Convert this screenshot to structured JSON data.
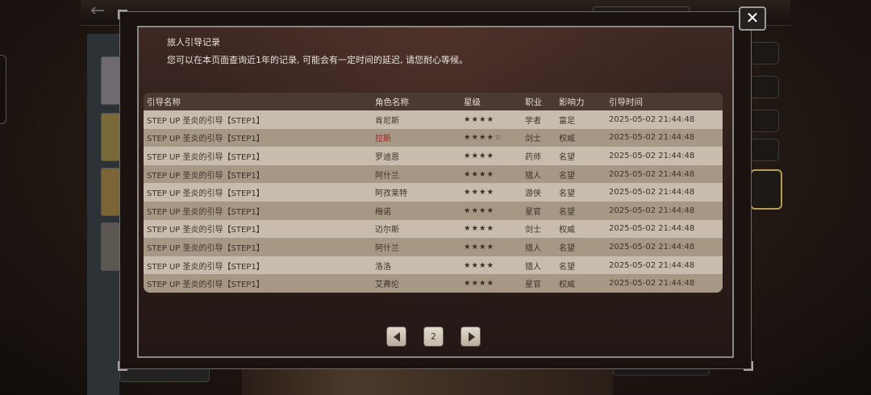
{
  "modal": {
    "title": "旅人引导记录",
    "description": "您可以在本页面查询近1年的记录, 可能会有一定时间的延迟, 请您耐心等候。",
    "close_icon": "✕"
  },
  "table": {
    "headers": [
      "引导名称",
      "角色名称",
      "星级",
      "职业",
      "影响力",
      "引导时间"
    ],
    "rows": [
      {
        "guide": "STEP UP 圣炎的引导【STEP1】",
        "character": "肯尼斯",
        "stars": "★★★★",
        "job": "学者",
        "influence": "富足",
        "time": "2025-05-02 21:44:48"
      },
      {
        "guide": "STEP UP 圣炎的引导【STEP1】",
        "character": "拉斯",
        "stars": "★★★★☆",
        "job": "剑士",
        "influence": "权威",
        "time": "2025-05-02 21:44:48"
      },
      {
        "guide": "STEP UP 圣炎的引导【STEP1】",
        "character": "罗迪恩",
        "stars": "★★★★",
        "job": "药师",
        "influence": "名望",
        "time": "2025-05-02 21:44:48"
      },
      {
        "guide": "STEP UP 圣炎的引导【STEP1】",
        "character": "阿什兰",
        "stars": "★★★★",
        "job": "猎人",
        "influence": "名望",
        "time": "2025-05-02 21:44:48"
      },
      {
        "guide": "STEP UP 圣炎的引导【STEP1】",
        "character": "阿孜莱特",
        "stars": "★★★★",
        "job": "游侠",
        "influence": "名望",
        "time": "2025-05-02 21:44:48"
      },
      {
        "guide": "STEP UP 圣炎的引导【STEP1】",
        "character": "梅诺",
        "stars": "★★★★",
        "job": "星官",
        "influence": "名望",
        "time": "2025-05-02 21:44:48"
      },
      {
        "guide": "STEP UP 圣炎的引导【STEP1】",
        "character": "迈尔斯",
        "stars": "★★★★",
        "job": "剑士",
        "influence": "权威",
        "time": "2025-05-02 21:44:48"
      },
      {
        "guide": "STEP UP 圣炎的引导【STEP1】",
        "character": "阿什兰",
        "stars": "★★★★",
        "job": "猎人",
        "influence": "名望",
        "time": "2025-05-02 21:44:48"
      },
      {
        "guide": "STEP UP 圣炎的引导【STEP1】",
        "character": "洛洛",
        "stars": "★★★★",
        "job": "猎人",
        "influence": "名望",
        "time": "2025-05-02 21:44:48"
      },
      {
        "guide": "STEP UP 圣炎的引导【STEP1】",
        "character": "艾弗伦",
        "stars": "★★★★",
        "job": "星官",
        "influence": "权威",
        "time": "2025-05-02 21:44:48"
      }
    ]
  },
  "pagination": {
    "current_page": "2",
    "prev_icon": "prev-arrow-icon",
    "next_icon": "next-arrow-icon"
  },
  "colors": {
    "highlight_name": "#a32222",
    "row_light": "#c7bcad",
    "row_dark": "#a79886",
    "header_bg": "#4a3a31"
  }
}
